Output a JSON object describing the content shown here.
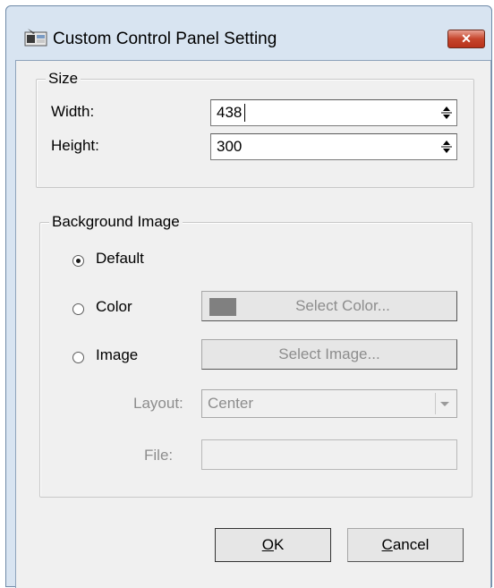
{
  "window": {
    "title": "Custom Control Panel Setting",
    "icon": "control-panel-icon",
    "close_glyph": "✕"
  },
  "size_group": {
    "legend": "Size",
    "width_label": "Width:",
    "width_value": "438",
    "height_label": "Height:",
    "height_value": "300"
  },
  "background_group": {
    "legend": "Background Image",
    "selected": "default",
    "options": {
      "default": "Default",
      "color": "Color",
      "image": "Image"
    },
    "select_color_label": "Select Color...",
    "swatch_color": "#808080",
    "select_image_label": "Select Image...",
    "layout_label": "Layout:",
    "layout_value": "Center",
    "file_label": "File:",
    "file_value": ""
  },
  "buttons": {
    "ok_mnemonic": "O",
    "ok_rest": "K",
    "cancel_mnemonic": "C",
    "cancel_rest": "ancel"
  }
}
